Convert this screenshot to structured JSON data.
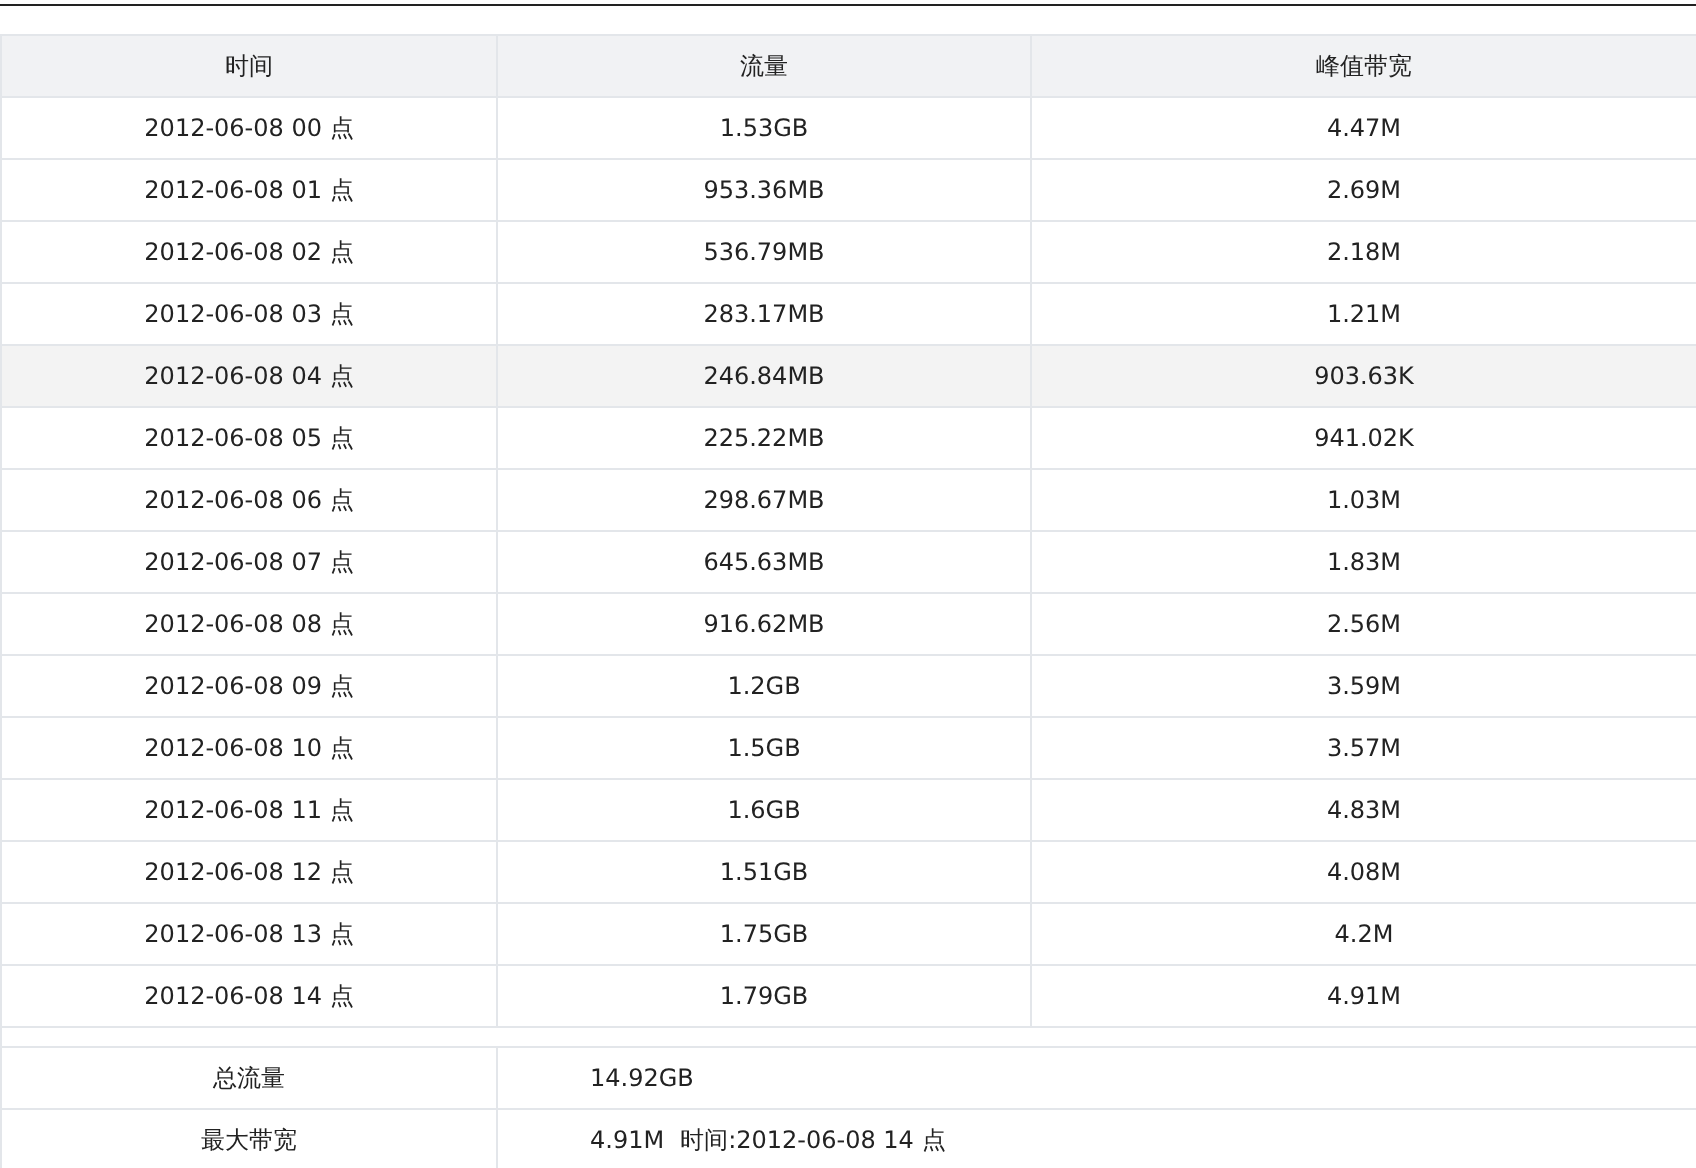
{
  "table": {
    "columns": [
      "时间",
      "流量",
      "峰值带宽"
    ],
    "rows": [
      {
        "time": "2012-06-08 00 点",
        "traffic": "1.53GB",
        "peak": "4.47M",
        "highlighted": false
      },
      {
        "time": "2012-06-08 01 点",
        "traffic": "953.36MB",
        "peak": "2.69M",
        "highlighted": false
      },
      {
        "time": "2012-06-08 02 点",
        "traffic": "536.79MB",
        "peak": "2.18M",
        "highlighted": false
      },
      {
        "time": "2012-06-08 03 点",
        "traffic": "283.17MB",
        "peak": "1.21M",
        "highlighted": false
      },
      {
        "time": "2012-06-08 04 点",
        "traffic": "246.84MB",
        "peak": "903.63K",
        "highlighted": true
      },
      {
        "time": "2012-06-08 05 点",
        "traffic": "225.22MB",
        "peak": "941.02K",
        "highlighted": false
      },
      {
        "time": "2012-06-08 06 点",
        "traffic": "298.67MB",
        "peak": "1.03M",
        "highlighted": false
      },
      {
        "time": "2012-06-08 07 点",
        "traffic": "645.63MB",
        "peak": "1.83M",
        "highlighted": false
      },
      {
        "time": "2012-06-08 08 点",
        "traffic": "916.62MB",
        "peak": "2.56M",
        "highlighted": false
      },
      {
        "time": "2012-06-08 09 点",
        "traffic": "1.2GB",
        "peak": "3.59M",
        "highlighted": false
      },
      {
        "time": "2012-06-08 10 点",
        "traffic": "1.5GB",
        "peak": "3.57M",
        "highlighted": false
      },
      {
        "time": "2012-06-08 11 点",
        "traffic": "1.6GB",
        "peak": "4.83M",
        "highlighted": false
      },
      {
        "time": "2012-06-08 12 点",
        "traffic": "1.51GB",
        "peak": "4.08M",
        "highlighted": false
      },
      {
        "time": "2012-06-08 13 点",
        "traffic": "1.75GB",
        "peak": "4.2M",
        "highlighted": false
      },
      {
        "time": "2012-06-08 14 点",
        "traffic": "1.79GB",
        "peak": "4.91M",
        "highlighted": false
      }
    ]
  },
  "summary": [
    {
      "label": "总流量",
      "values": [
        "14.92GB"
      ]
    },
    {
      "label": "最大带宽",
      "values": [
        "4.91M",
        "时间:2012-06-08 14 点"
      ]
    }
  ]
}
